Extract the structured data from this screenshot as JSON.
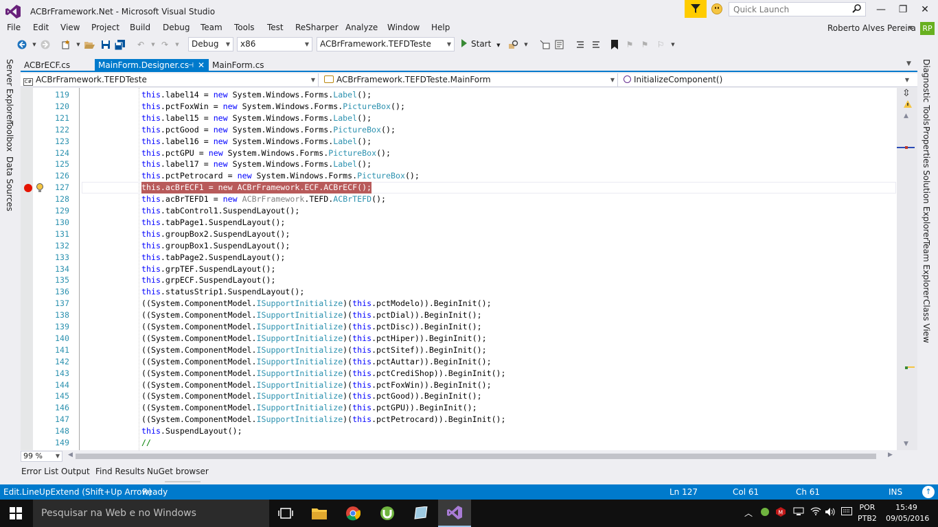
{
  "window": {
    "title": "ACBrFramework.Net - Microsoft Visual Studio",
    "quick_launch_placeholder": "Quick Launch"
  },
  "menu": {
    "items": [
      "File",
      "Edit",
      "View",
      "Project",
      "Build",
      "Debug",
      "Team",
      "Tools",
      "Test",
      "ReSharper",
      "Analyze",
      "Window",
      "Help"
    ],
    "user_name": "Roberto Alves Pereira",
    "user_initials": "RP"
  },
  "toolbar": {
    "configuration": "Debug",
    "platform": "x86",
    "startup_project": "ACBrFramework.TEFDTeste",
    "start_label": "Start"
  },
  "side_tabs": {
    "left": [
      "Server Explorer",
      "Toolbox",
      "Data Sources"
    ],
    "right": [
      "Diagnostic Tools",
      "Properties",
      "Solution Explorer",
      "Team Explorer",
      "Class View"
    ]
  },
  "doc_tabs": [
    {
      "label": "ACBrECF.cs",
      "active": false
    },
    {
      "label": "MainForm.Designer.cs",
      "active": true
    },
    {
      "label": "MainForm.cs",
      "active": false
    }
  ],
  "nav_bar": {
    "project": "ACBrFramework.TEFDTeste",
    "project_icon": "C#",
    "type": "ACBrFramework.TEFDTeste.MainForm",
    "member": "InitializeComponent()"
  },
  "editor": {
    "current_line": 127,
    "lines": [
      {
        "n": "119",
        "code": "this.label14 = new System.Windows.Forms.Label();"
      },
      {
        "n": "120",
        "code": "this.pctFoxWin = new System.Windows.Forms.PictureBox();"
      },
      {
        "n": "121",
        "code": "this.label15 = new System.Windows.Forms.Label();"
      },
      {
        "n": "122",
        "code": "this.pctGood = new System.Windows.Forms.PictureBox();"
      },
      {
        "n": "123",
        "code": "this.label16 = new System.Windows.Forms.Label();"
      },
      {
        "n": "124",
        "code": "this.pctGPU = new System.Windows.Forms.PictureBox();"
      },
      {
        "n": "125",
        "code": "this.label17 = new System.Windows.Forms.Label();"
      },
      {
        "n": "126",
        "code": "this.pctPetrocard = new System.Windows.Forms.PictureBox();"
      },
      {
        "n": "127",
        "code": "this.acBrECF1 = new ACBrFramework.ECF.ACBrECF();"
      },
      {
        "n": "128",
        "code": "this.acBrTEFD1 = new ACBrFramework.TEFD.ACBrTEFD();"
      },
      {
        "n": "129",
        "code": "this.tabControl1.SuspendLayout();"
      },
      {
        "n": "130",
        "code": "this.tabPage1.SuspendLayout();"
      },
      {
        "n": "131",
        "code": "this.groupBox2.SuspendLayout();"
      },
      {
        "n": "132",
        "code": "this.groupBox1.SuspendLayout();"
      },
      {
        "n": "133",
        "code": "this.tabPage2.SuspendLayout();"
      },
      {
        "n": "134",
        "code": "this.grpTEF.SuspendLayout();"
      },
      {
        "n": "135",
        "code": "this.grpECF.SuspendLayout();"
      },
      {
        "n": "136",
        "code": "this.statusStrip1.SuspendLayout();"
      },
      {
        "n": "137",
        "code": "((System.ComponentModel.ISupportInitialize)(this.pctModelo)).BeginInit();"
      },
      {
        "n": "138",
        "code": "((System.ComponentModel.ISupportInitialize)(this.pctDial)).BeginInit();"
      },
      {
        "n": "139",
        "code": "((System.ComponentModel.ISupportInitialize)(this.pctDisc)).BeginInit();"
      },
      {
        "n": "140",
        "code": "((System.ComponentModel.ISupportInitialize)(this.pctHiper)).BeginInit();"
      },
      {
        "n": "141",
        "code": "((System.ComponentModel.ISupportInitialize)(this.pctSitef)).BeginInit();"
      },
      {
        "n": "142",
        "code": "((System.ComponentModel.ISupportInitialize)(this.pctAuttar)).BeginInit();"
      },
      {
        "n": "143",
        "code": "((System.ComponentModel.ISupportInitialize)(this.pctCrediShop)).BeginInit();"
      },
      {
        "n": "144",
        "code": "((System.ComponentModel.ISupportInitialize)(this.pctFoxWin)).BeginInit();"
      },
      {
        "n": "145",
        "code": "((System.ComponentModel.ISupportInitialize)(this.pctGood)).BeginInit();"
      },
      {
        "n": "146",
        "code": "((System.ComponentModel.ISupportInitialize)(this.pctGPU)).BeginInit();"
      },
      {
        "n": "147",
        "code": "((System.ComponentModel.ISupportInitialize)(this.pctPetrocard)).BeginInit();"
      },
      {
        "n": "148",
        "code": "this.SuspendLayout();"
      },
      {
        "n": "149",
        "code": "//"
      }
    ]
  },
  "zoom_level": "99 %",
  "bottom_tabs": [
    "Error List",
    "Output",
    "Find Results",
    "NuGet browser"
  ],
  "status_bar": {
    "command": "Edit.LineUpExtend (Shift+Up Arrow)",
    "state": "Ready",
    "line": "Ln 127",
    "col": "Col 61",
    "ch": "Ch 61",
    "mode": "INS"
  },
  "taskbar": {
    "search_placeholder": "Pesquisar na Web e no Windows",
    "language": "POR",
    "keyboard": "PTB2",
    "time": "15:49",
    "date": "09/05/2016"
  },
  "colors": {
    "accent": "#007acc",
    "keyword": "#0000ff",
    "type": "#2b91af",
    "breakpoint": "#e51400",
    "breakpoint_highlight": "#b85a5a"
  }
}
